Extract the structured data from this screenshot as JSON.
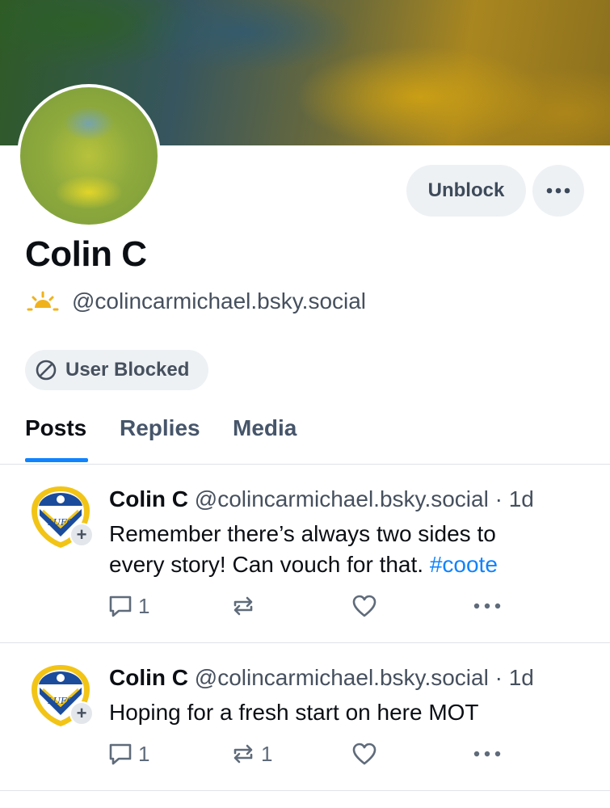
{
  "profile": {
    "display_name": "Colin C",
    "handle": "@colincarmichael.bsky.social",
    "status_icon": "sun-icon",
    "blocked_label": "User Blocked"
  },
  "actions": {
    "unblock_label": "Unblock",
    "more_icon": "ellipsis-icon"
  },
  "tabs": [
    {
      "label": "Posts",
      "active": true
    },
    {
      "label": "Replies",
      "active": false
    },
    {
      "label": "Media",
      "active": false
    }
  ],
  "posts": [
    {
      "author": "Colin C",
      "handle": "@colincarmichael.bsky.social",
      "time": "1d",
      "text_line1": "Remember there’s always two sides to",
      "text_line2": "every story! Can vouch for that. ",
      "hashtag": "#coote",
      "replies": "1",
      "reposts": "",
      "likes": ""
    },
    {
      "author": "Colin C",
      "handle": "@colincarmichael.bsky.social",
      "time": "1d",
      "text_line1": "Hoping for a fresh start on here MOT",
      "replies": "1",
      "reposts": "1",
      "likes": ""
    }
  ],
  "colors": {
    "accent": "#1083fe",
    "button_bg": "#eef1f4",
    "muted_text": "#46505e"
  }
}
